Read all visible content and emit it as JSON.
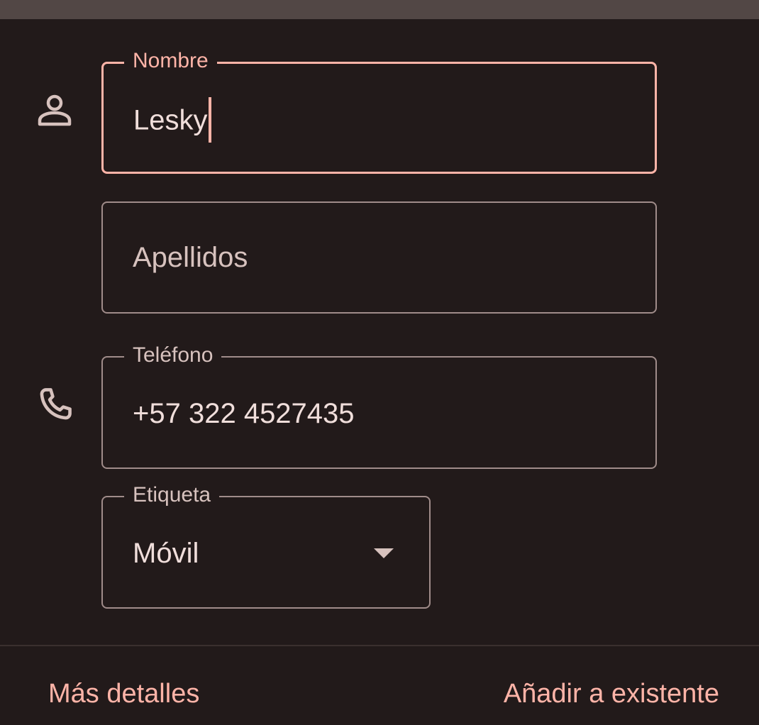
{
  "form": {
    "first_name": {
      "label": "Nombre",
      "value": "Lesky"
    },
    "last_name": {
      "placeholder": "Apellidos"
    },
    "phone": {
      "label": "Teléfono",
      "value": "+57 322 4527435"
    },
    "phone_label": {
      "label": "Etiqueta",
      "selected": "Móvil"
    }
  },
  "icons": {
    "name_icon": "person-icon",
    "phone_icon": "phone-icon",
    "dropdown_icon": "dropdown-arrow-icon"
  },
  "footer": {
    "more_details": "Más detalles",
    "add_to_existing": "Añadir a existente"
  },
  "colors": {
    "background": "#221a1a",
    "accent": "#ffb4a8",
    "outline": "#a08c8a",
    "on_surface_variant": "#d7c2be"
  }
}
